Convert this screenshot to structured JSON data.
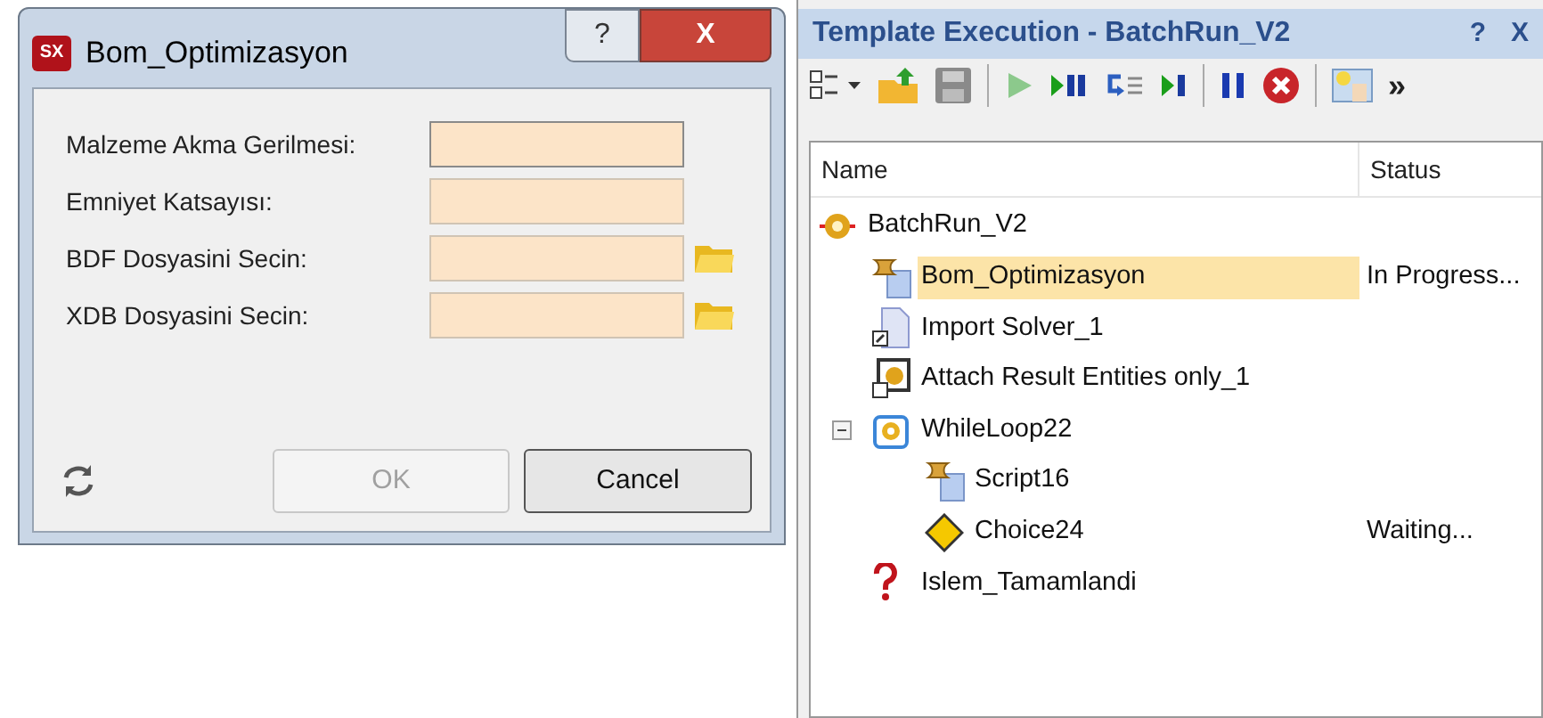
{
  "dialog": {
    "title": "Bom_Optimizasyon",
    "logo": "SX",
    "help": "?",
    "close": "X",
    "fields": [
      {
        "label": "Malzeme Akma Gerilmesi:",
        "focused": true,
        "browse": false
      },
      {
        "label": "Emniyet Katsayısı:",
        "focused": false,
        "browse": false
      },
      {
        "label": "BDF Dosyasini Secin:",
        "focused": false,
        "browse": true
      },
      {
        "label": "XDB Dosyasini Secin:",
        "focused": false,
        "browse": true
      }
    ],
    "buttons": [
      {
        "label": "OK",
        "disabled": true
      },
      {
        "label": "Cancel",
        "disabled": false
      }
    ]
  },
  "panel": {
    "title": "Template Execution - BatchRun_V2",
    "help": "?",
    "close": "X",
    "toolbar_more": "»",
    "columns": [
      "Name",
      "Status"
    ],
    "tree": [
      {
        "name": "BatchRun_V2",
        "kind": "batch",
        "selected": false,
        "children": [
          {
            "name": "Bom_Optimizasyon",
            "kind": "script",
            "selected": true,
            "status": "In Progress..."
          },
          {
            "name": "Import Solver_1",
            "kind": "import",
            "selected": false
          },
          {
            "name": "Attach Result Entities only_1",
            "kind": "attach",
            "selected": false
          },
          {
            "name": "WhileLoop22",
            "kind": "loop",
            "selected": false,
            "expanded": true,
            "children": [
              {
                "name": "Script16",
                "kind": "script",
                "selected": false
              },
              {
                "name": "Choice24",
                "kind": "choice",
                "selected": false,
                "status": "Waiting..."
              }
            ]
          },
          {
            "name": "Islem_Tamamlandi",
            "kind": "question",
            "selected": false
          }
        ]
      }
    ]
  }
}
